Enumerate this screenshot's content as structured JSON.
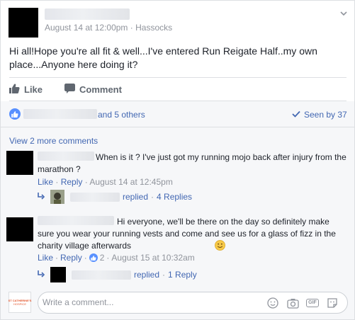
{
  "post": {
    "timestamp": "August 14 at 12:00pm",
    "location_sep": "·",
    "location": "Hassocks",
    "text": "Hi all!Hope you're all fit & well...I've entered Run Reigate Half..my own place...Anyone here doing it?",
    "like_label": "Like",
    "comment_label": "Comment"
  },
  "reactions": {
    "others": "and 5 others",
    "seen_by": "Seen by 37"
  },
  "comments": {
    "view_more": "View 2 more comments",
    "items": [
      {
        "text": "When is it ? I've just got my running mojo back after injury from the marathon ?",
        "like": "Like",
        "reply": "Reply",
        "dot": "·",
        "time": "August 14 at 12:45pm",
        "replied": "replied",
        "replies": "4 Replies"
      },
      {
        "text": "Hi everyone, we'll be there on the day so definitely make sure you wear your running vests and come and see us for a glass of fizz in the charity village afterwards",
        "like": "Like",
        "reply": "Reply",
        "dot": "·",
        "like_count": "2",
        "time": "August 15 at 10:32am",
        "replied": "replied",
        "replies": "1 Reply"
      }
    ]
  },
  "composer": {
    "placeholder": "Write a comment...",
    "brand_line1": "ST CATHERINE'S",
    "brand_line2": "HOSPICE",
    "gif_label": "GIF"
  },
  "colors": {
    "link": "#4267b2",
    "meta": "#90949c",
    "brand": "#e4572e"
  }
}
